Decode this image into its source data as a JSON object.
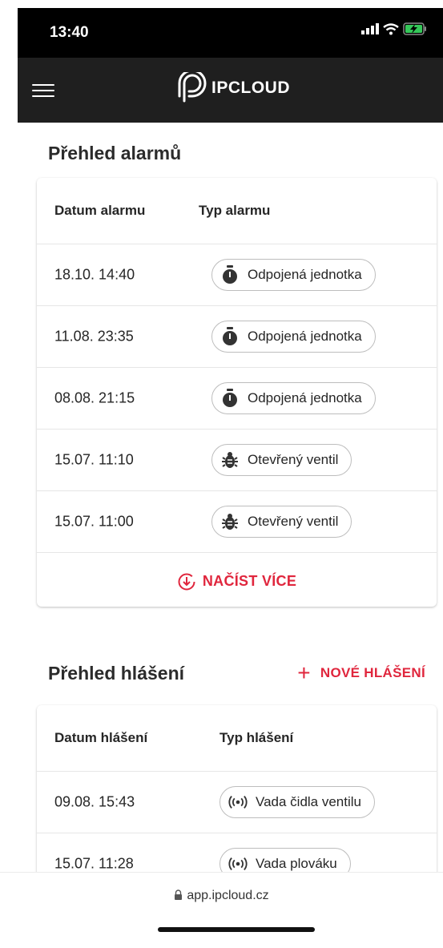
{
  "status_bar": {
    "time": "13:40"
  },
  "header": {
    "brand": "IPCLOUD"
  },
  "alarms": {
    "title": "Přehled alarmů",
    "col_date": "Datum alarmu",
    "col_type": "Typ alarmu",
    "rows": [
      {
        "date": "18.10. 14:40",
        "type": "Odpojená jednotka",
        "icon": "stopwatch-icon"
      },
      {
        "date": "11.08. 23:35",
        "type": "Odpojená jednotka",
        "icon": "stopwatch-icon"
      },
      {
        "date": "08.08. 21:15",
        "type": "Odpojená jednotka",
        "icon": "stopwatch-icon"
      },
      {
        "date": "15.07. 11:10",
        "type": "Otevřený ventil",
        "icon": "bug-icon"
      },
      {
        "date": "15.07. 11:00",
        "type": "Otevřený ventil",
        "icon": "bug-icon"
      }
    ],
    "load_more": "NAČÍST VÍCE"
  },
  "reports": {
    "title": "Přehled hlášení",
    "new_label": "NOVÉ HLÁŠENÍ",
    "col_date": "Datum hlášení",
    "col_type": "Typ hlášení",
    "rows": [
      {
        "date": "09.08. 15:43",
        "type": "Vada čidla ventilu",
        "icon": "broadcast-icon"
      },
      {
        "date": "15.07. 11:28",
        "type": "Vada plováku",
        "icon": "broadcast-icon"
      }
    ]
  },
  "browser": {
    "url": "app.ipcloud.cz"
  },
  "colors": {
    "accent": "#e0263d",
    "header_bg": "#1f1f1f",
    "status_bg": "#000000"
  }
}
